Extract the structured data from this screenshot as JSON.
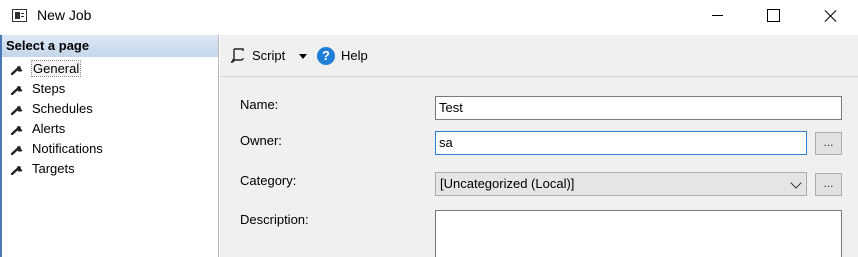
{
  "window": {
    "title": "New Job"
  },
  "left_panel": {
    "header": "Select a page",
    "items": [
      {
        "label": "General",
        "icon": "wrench-icon",
        "selected": true
      },
      {
        "label": "Steps",
        "icon": "wrench-icon"
      },
      {
        "label": "Schedules",
        "icon": "wrench-icon"
      },
      {
        "label": "Alerts",
        "icon": "wrench-icon"
      },
      {
        "label": "Notifications",
        "icon": "wrench-icon"
      },
      {
        "label": "Targets",
        "icon": "wrench-icon"
      }
    ]
  },
  "toolbar": {
    "script_label": "Script",
    "help_label": "Help",
    "help_glyph": "?"
  },
  "form": {
    "name_label": "Name:",
    "name_value": "Test",
    "owner_label": "Owner:",
    "owner_value": "sa",
    "category_label": "Category:",
    "category_value": "[Uncategorized (Local)]",
    "description_label": "Description:",
    "description_value": "",
    "ellipsis": "..."
  },
  "colors": {
    "accent": "#2f7fd4",
    "help_icon": "#1f7fd8",
    "panel_bg": "#f0f0f0"
  }
}
